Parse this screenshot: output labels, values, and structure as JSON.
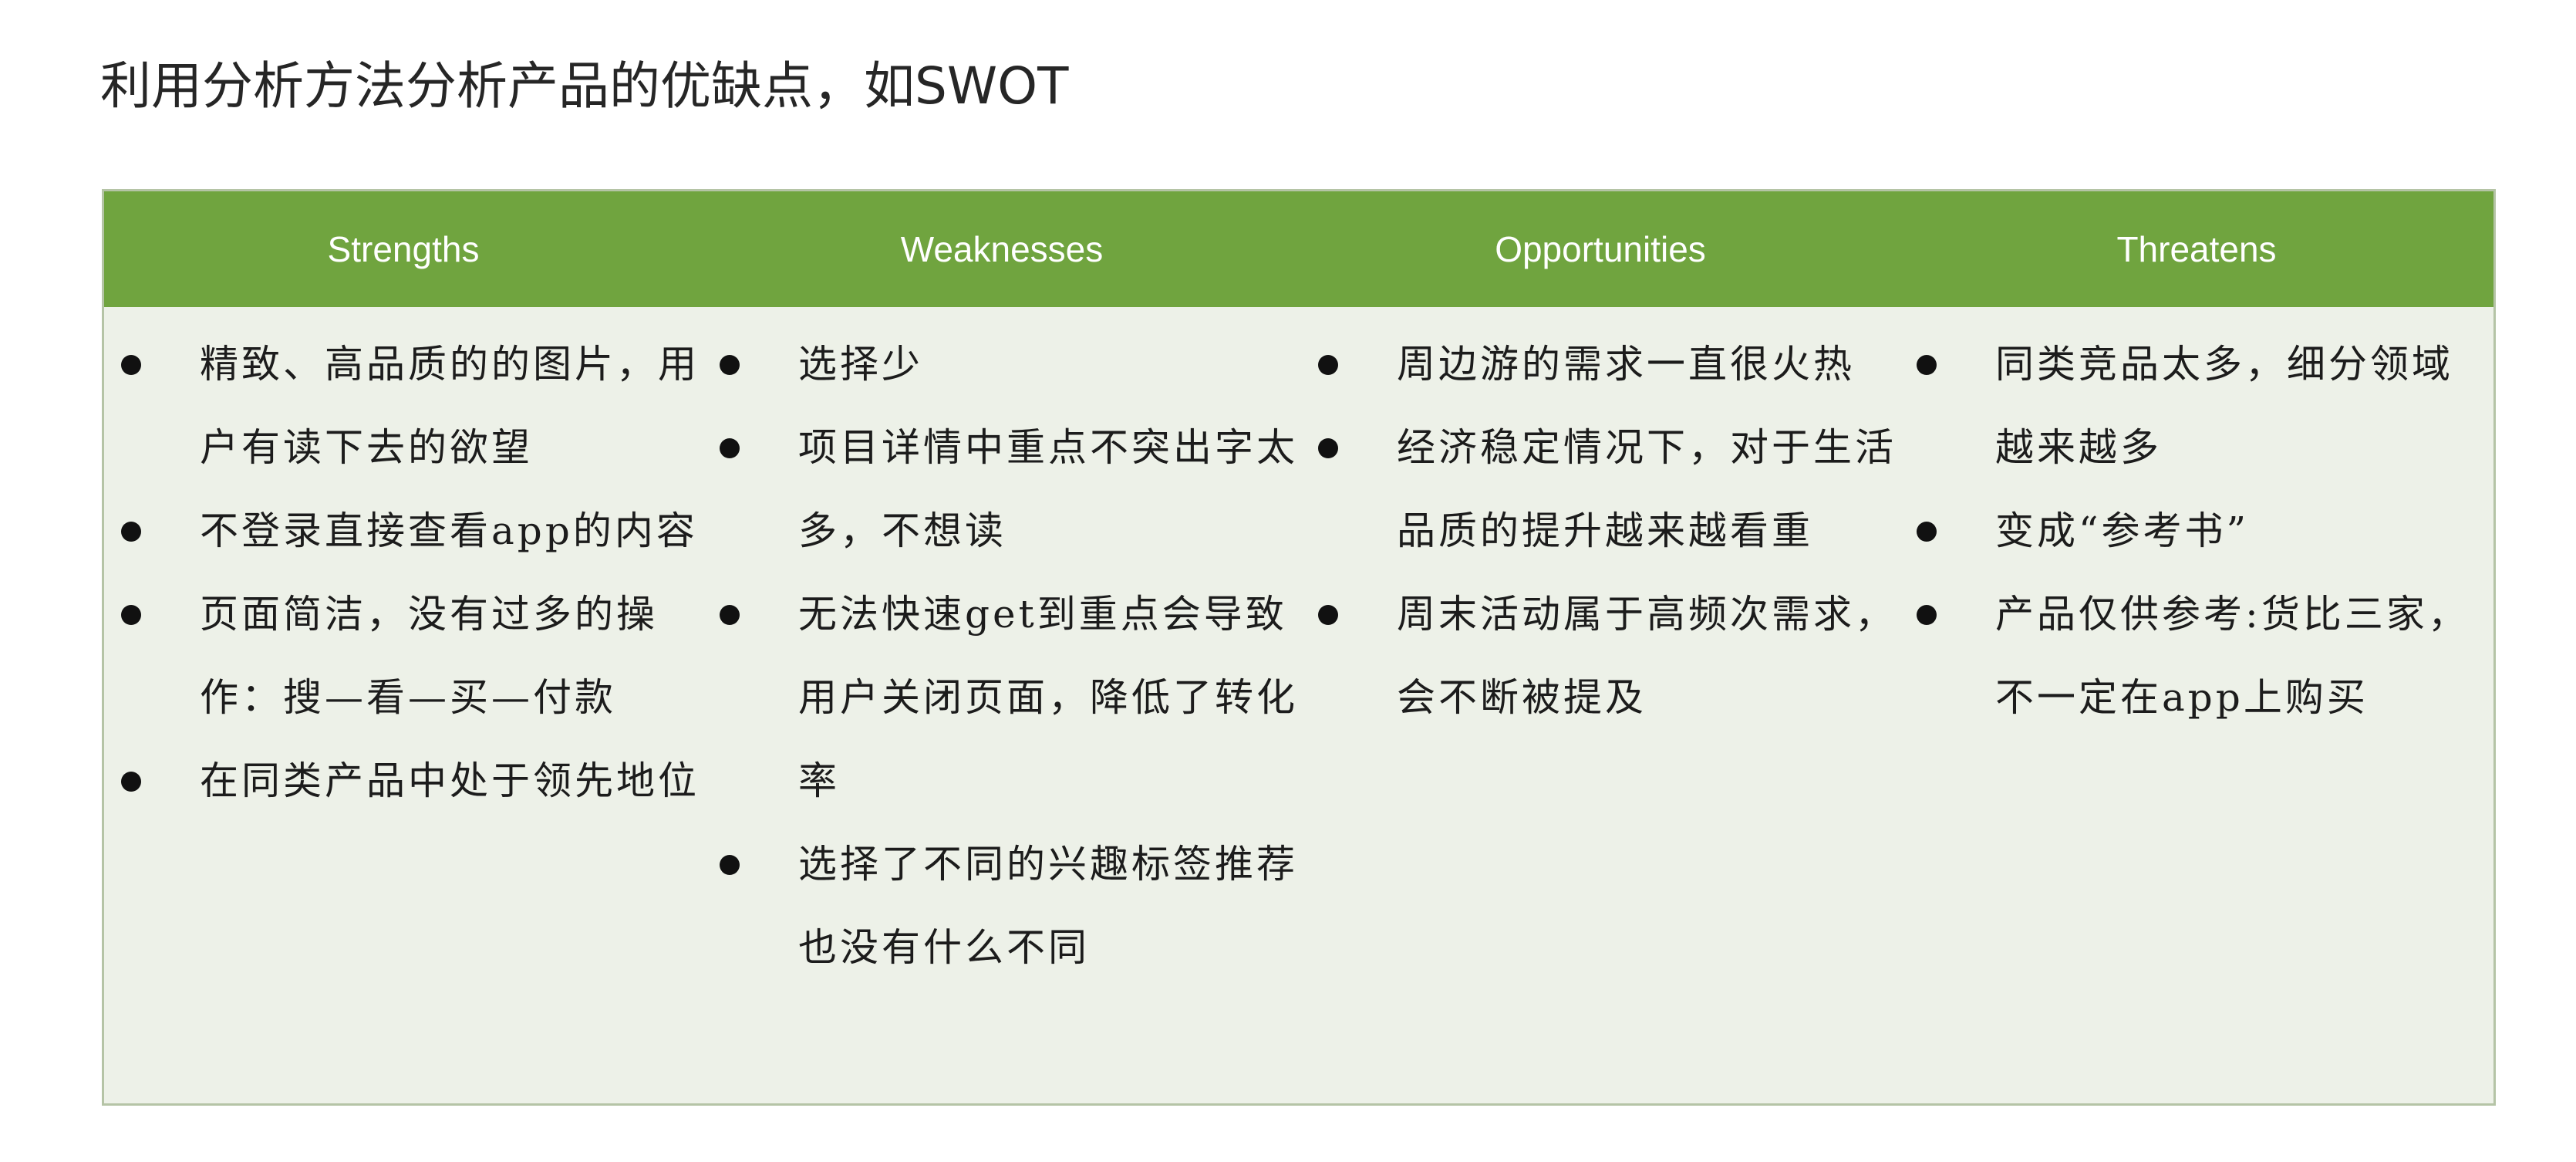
{
  "title": "利用分析方法分析产品的优缺点，如SWOT",
  "swot": {
    "headers": [
      "Strengths",
      "Weaknesses",
      "Opportunities",
      "Threatens"
    ],
    "strengths": [
      "精致、高品质的的图片，用户有读下去的欲望",
      "不登录直接查看app的内容",
      "页面简洁，没有过多的操作：搜—看—买—付款",
      "在同类产品中处于领先地位"
    ],
    "weaknesses": [
      "选择少",
      "项目详情中重点不突出字太多，不想读",
      "无法快速get到重点会导致用户关闭页面，降低了转化率",
      "选择了不同的兴趣标签推荐也没有什么不同"
    ],
    "opportunities": [
      "周边游的需求一直很火热",
      "经济稳定情况下，对于生活品质的提升越来越看重",
      "周末活动属于高频次需求，会不断被提及"
    ],
    "threatens": [
      "同类竞品太多，细分领域越来越多",
      "变成“参考书”",
      "产品仅供参考:货比三家，不一定在app上购买"
    ]
  }
}
